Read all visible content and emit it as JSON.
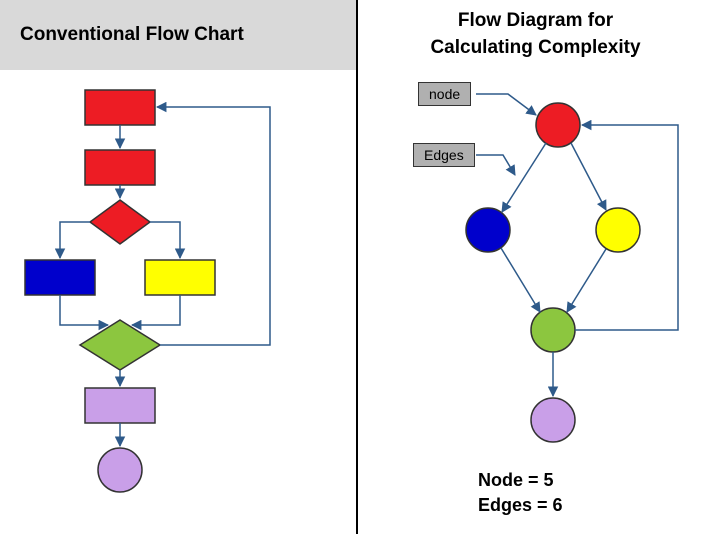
{
  "left": {
    "title": "Conventional Flow Chart"
  },
  "right": {
    "title_line1": "Flow Diagram for",
    "title_line2": "Calculating Complexity",
    "legend_node": "node",
    "legend_edges": "Edges",
    "summary_node": "Node  = 5",
    "summary_edges": "Edges = 6"
  },
  "colors": {
    "red": "#ed1c24",
    "blue": "#0000cc",
    "yellow": "#ffff00",
    "green": "#8cc63f",
    "purple": "#c99fe8",
    "arrow": "#2e5a8a",
    "stroke": "#333"
  }
}
